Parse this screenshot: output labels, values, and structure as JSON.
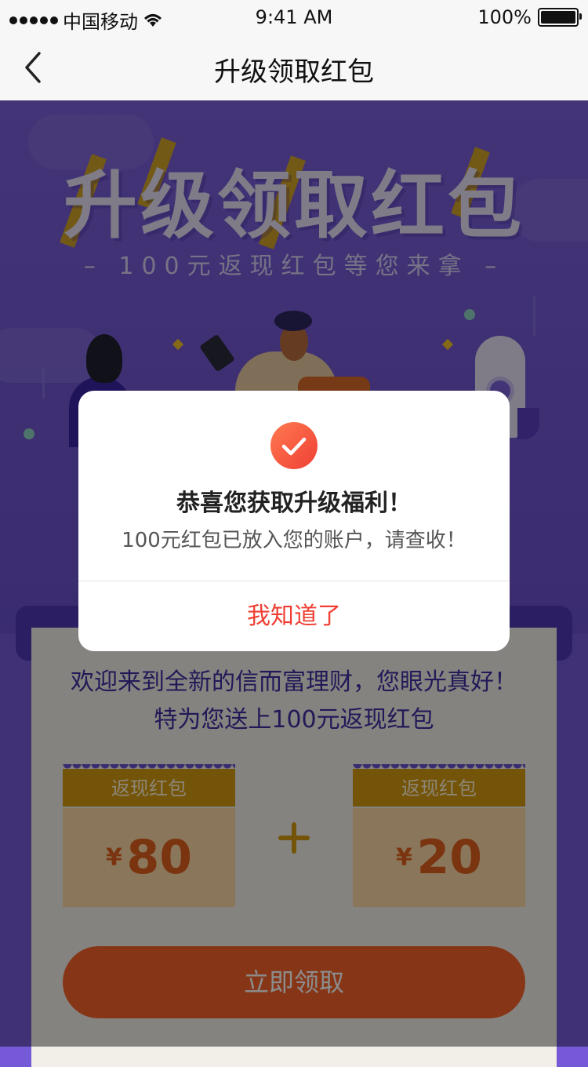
{
  "status_bar": {
    "carrier": "中国移动",
    "time": "9:41 AM",
    "battery": "100%"
  },
  "nav": {
    "title": "升级领取红包"
  },
  "hero": {
    "title": "升级领取红包",
    "subtitle": "– 100元返现红包等您来拿 –"
  },
  "card": {
    "welcome_line1": "欢迎来到全新的信而富理财，您眼光真好！",
    "welcome_line2": "特为您送上100元返现红包",
    "coupons": [
      {
        "label": "返现红包",
        "currency": "¥",
        "amount": "80"
      },
      {
        "label": "返现红包",
        "currency": "¥",
        "amount": "20"
      }
    ],
    "claim_button": "立即领取"
  },
  "dialog": {
    "title": "恭喜您获取升级福利！",
    "message": "100元红包已放入您的账户，请查收！",
    "button": "我知道了"
  },
  "colors": {
    "accent": "#ef3f34",
    "hero_purple": "#7559d6",
    "coupon_gold": "#d49a10"
  }
}
